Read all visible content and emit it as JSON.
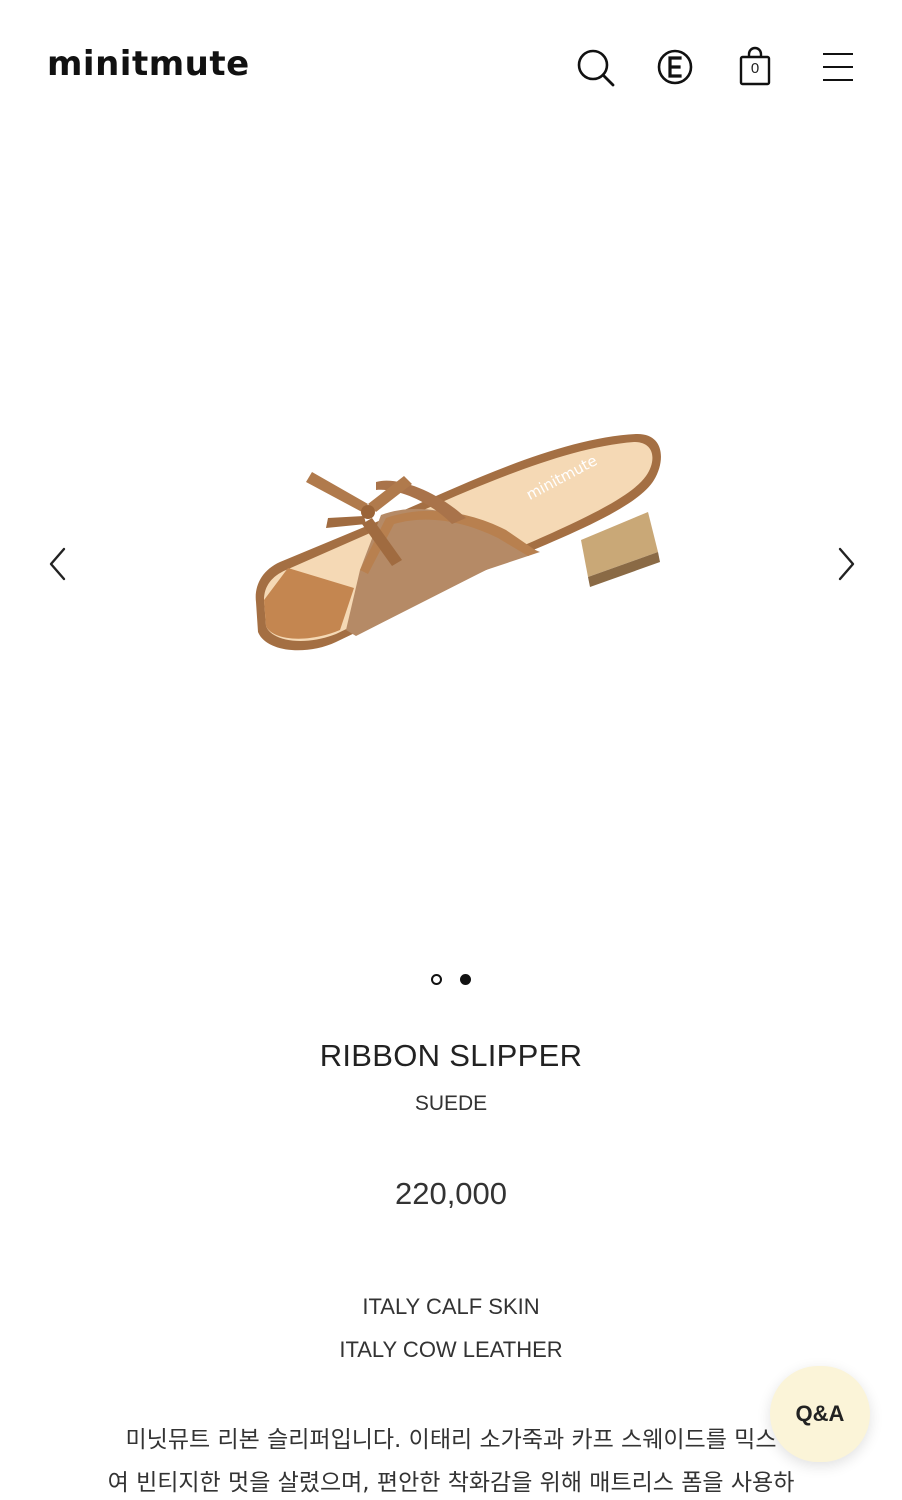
{
  "header": {
    "logo": "minitmute",
    "cart_count": "0",
    "icons": [
      "search-icon",
      "e-badge-icon",
      "shopping-bag-icon",
      "hamburger-menu-icon"
    ]
  },
  "gallery": {
    "slide_count": 2,
    "active_slide": 2,
    "icons": [
      "chevron-left-icon",
      "chevron-right-icon"
    ]
  },
  "product": {
    "name": "RIBBON SLIPPER",
    "variant": "SUEDE",
    "price": "220,000",
    "materials": [
      "ITALY CALF SKIN",
      "ITALY COW LEATHER"
    ],
    "description_lines": [
      "미닛뮤트 리본 슬리퍼입니다. 이태리 소가죽과 카프 스웨이드를 믹스",
      "여 빈티지한 멋을 살렸으며, 편안한 착화감을 위해 매트리스 폼을 사용하"
    ],
    "image_brand_stamp": "minitmute"
  },
  "qa_button": {
    "label": "Q&A"
  },
  "colors": {
    "text": "#222222",
    "leather": "#b07a4c",
    "suede": "#b58a66",
    "insole": "#f5d9b5",
    "qa_background": "#fbf4d8"
  }
}
